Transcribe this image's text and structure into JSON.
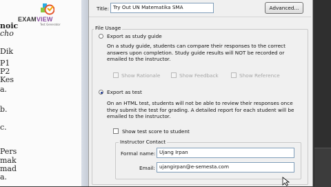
{
  "background_doc": {
    "lines": [
      "noic",
      "cho",
      "Dik",
      "P1",
      "P2",
      "Kes",
      "a.",
      "b.",
      "c.",
      "Pers",
      "mak",
      "mad",
      "a."
    ],
    "logo_main": "EXAM",
    "logo_accent": "VIEW",
    "logo_tagline": "Test Generator"
  },
  "dialog": {
    "title_label": "Title:",
    "title_value": "Try Out UN Matematika SMA",
    "advanced_button": "Advanced...",
    "file_usage": {
      "legend": "File Usage",
      "study_guide": {
        "label": "Export as study guide",
        "selected": false,
        "description": [
          "On a study guide, students can compare their responses to the correct",
          "answers upon completion.  Study guide results will NOT be recorded or",
          "emailed to the instructor."
        ],
        "options": [
          {
            "label": "Show Rationale",
            "checked": false,
            "enabled": false
          },
          {
            "label": "Show Feedback",
            "checked": false,
            "enabled": false
          },
          {
            "label": "Show Reference",
            "checked": false,
            "enabled": false
          }
        ]
      },
      "test": {
        "label": "Export as test",
        "selected": true,
        "description": [
          "On an HTML test, students will not be able to review their responses once",
          "they submit the test for grading.  A detailed report for each student will be",
          "emailed to the instructor."
        ],
        "show_score_label": "Show test score to student",
        "show_score_checked": false
      }
    },
    "instructor": {
      "legend": "Instructor Contact",
      "name_label": "Formal name:",
      "name_value": "Ujang Irpan",
      "email_label": "Email:",
      "email_value": "ujangirpan@e-semesta.com"
    }
  },
  "colors": {
    "dialog_bg": "#f0f0f0",
    "input_border": "#7f9db9",
    "radio_dot": "#1f3a93",
    "logo_accent": "#8a4fa0"
  }
}
